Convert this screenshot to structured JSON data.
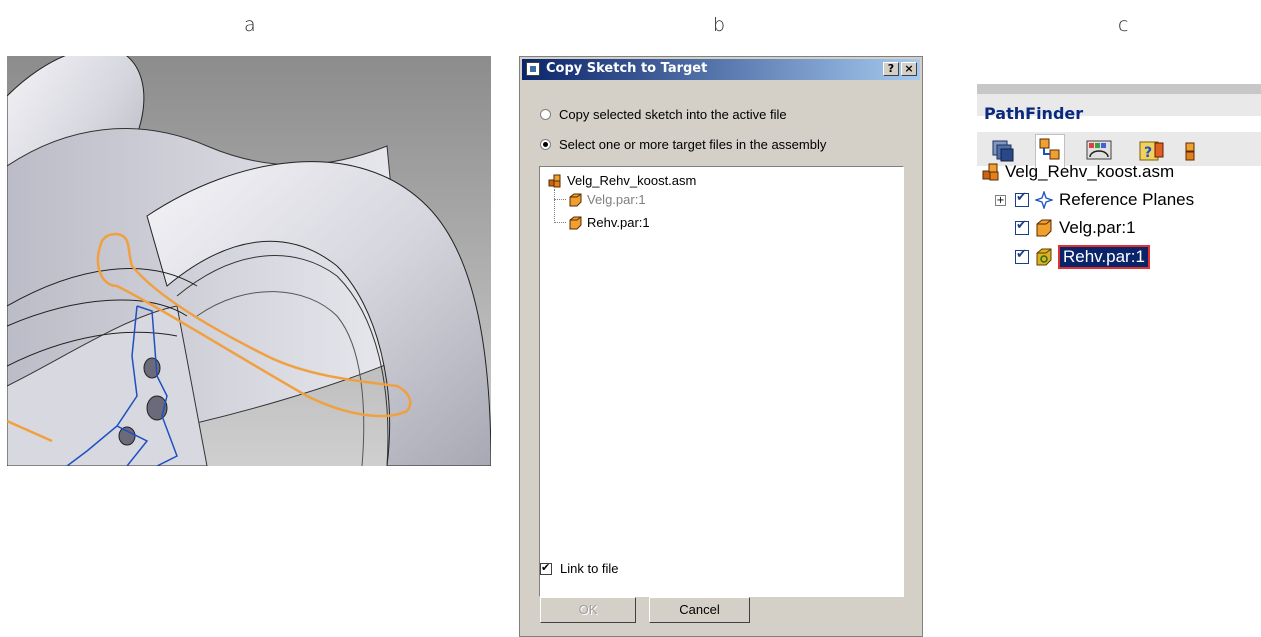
{
  "labels": {
    "a": "a",
    "b": "b",
    "c": "c"
  },
  "dialog": {
    "title": "Copy Sketch to Target",
    "help_button": "?",
    "close_button": "×",
    "option1": "Copy selected sketch into the active file",
    "option2": "Select one or more target files in the assembly",
    "selected_option": 2,
    "tree": {
      "root": "Velg_Rehv_koost.asm",
      "children": [
        "Velg.par:1",
        "Rehv.par:1"
      ]
    },
    "link_to_file_label": "Link to file",
    "link_to_file_checked": true,
    "ok_label": "OK",
    "cancel_label": "Cancel"
  },
  "pathfinder": {
    "title": "PathFinder",
    "root": "Velg_Rehv_koost.asm",
    "items": [
      "Reference Planes",
      "Velg.par:1",
      "Rehv.par:1"
    ],
    "selected_item": "Rehv.par:1"
  },
  "colors": {
    "titlebar_start": "#0a246a",
    "titlebar_end": "#a6caf0",
    "sketch_orange": "#f0a040",
    "sketch_blue": "#2050c0",
    "selection_outline": "#e03030"
  }
}
